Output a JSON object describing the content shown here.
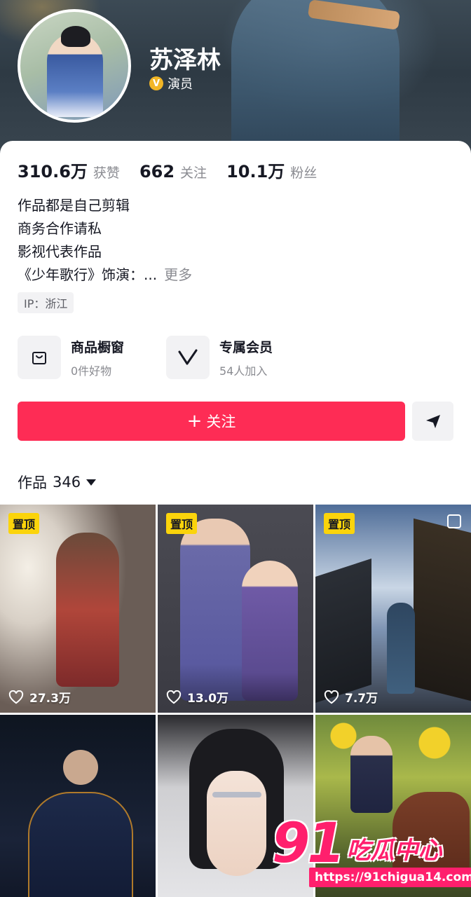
{
  "profile": {
    "name": "苏泽林",
    "verify_label": "演员",
    "verify_badge": "V"
  },
  "stats": [
    {
      "num": "310.6万",
      "label": "获赞"
    },
    {
      "num": "662",
      "label": "关注"
    },
    {
      "num": "10.1万",
      "label": "粉丝"
    }
  ],
  "bio": {
    "lines": [
      "作品都是自己剪辑",
      "商务合作请私",
      "影视代表作品",
      "《少年歌行》饰演：..."
    ],
    "more": "更多"
  },
  "ip_label": "IP：浙江",
  "features": [
    {
      "title": "商品橱窗",
      "sub": "0件好物",
      "icon": "shopping-bag-icon"
    },
    {
      "title": "专属会员",
      "sub": "54人加入",
      "icon": "membership-v-icon"
    }
  ],
  "follow_label": "关注",
  "works": {
    "label": "作品",
    "count": "346"
  },
  "tiles": [
    {
      "pinned": "置顶",
      "likes": "27.3万"
    },
    {
      "pinned": "置顶",
      "likes": "13.0万"
    },
    {
      "pinned": "置顶",
      "likes": "7.7万"
    },
    {
      "pinned": "",
      "likes": ""
    },
    {
      "pinned": "",
      "likes": ""
    },
    {
      "pinned": "",
      "likes": ""
    }
  ],
  "watermark": {
    "logo_num": "91",
    "logo_text": "吃瓜中心",
    "url": "https://91chigua14.com"
  },
  "colors": {
    "follow": "#fe2c55",
    "pinned_badge": "#fbd40b",
    "watermark": "#ff1f6d"
  }
}
